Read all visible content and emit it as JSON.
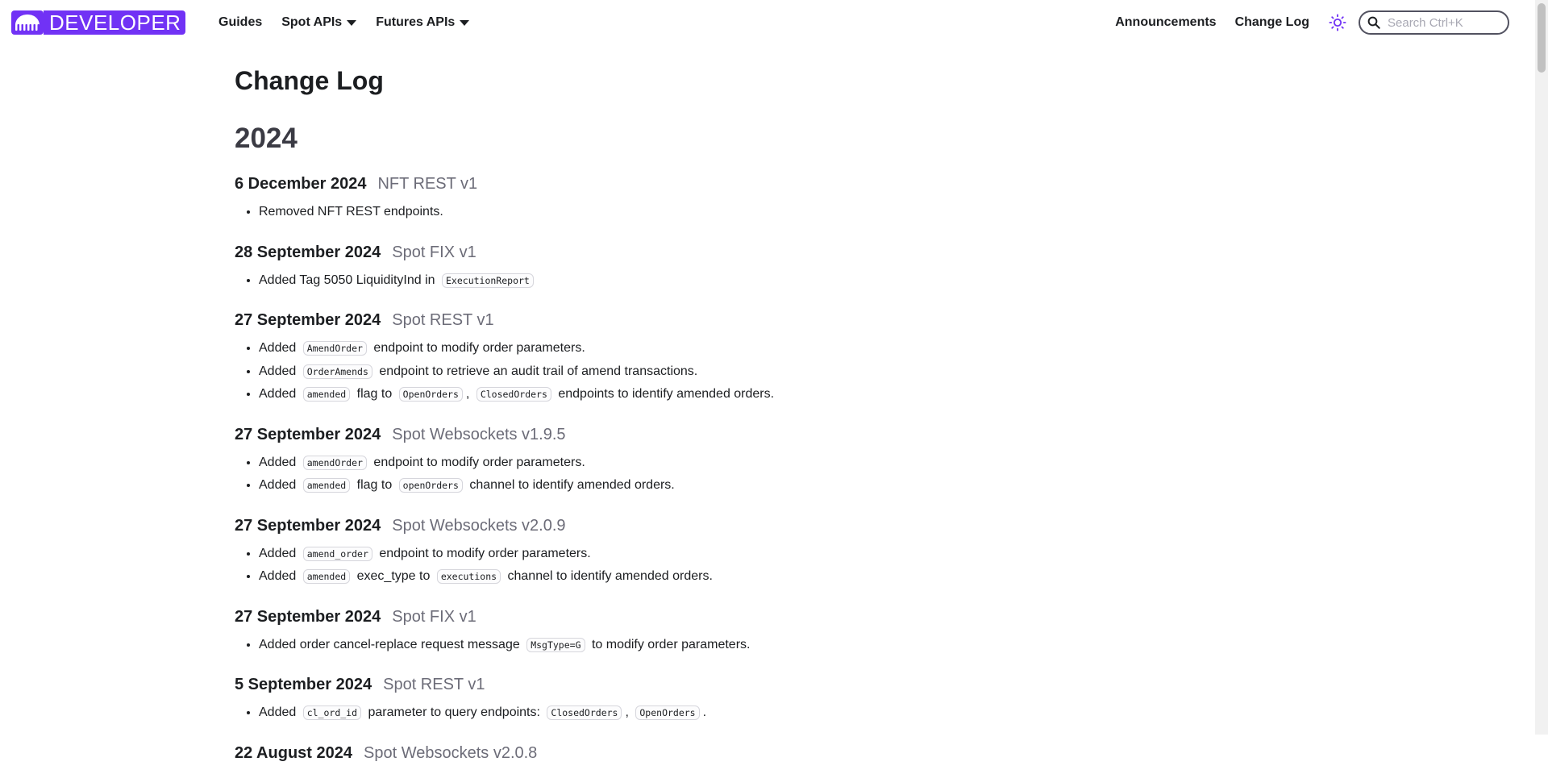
{
  "nav": {
    "logo_label": "DEVELOPER",
    "left_links": [
      {
        "label": "Guides",
        "dropdown": false
      },
      {
        "label": "Spot APIs",
        "dropdown": true
      },
      {
        "label": "Futures APIs",
        "dropdown": true
      }
    ],
    "right_links": [
      "Announcements",
      "Change Log"
    ],
    "search_placeholder": "Search Ctrl+K",
    "theme_icon": "sun-icon"
  },
  "colors": {
    "brand": "#7132f5",
    "tag": "#6c6c78"
  },
  "page": {
    "title": "Change Log",
    "year": "2024"
  },
  "entries": [
    {
      "date": "6 December 2024",
      "tag": "NFT REST v1",
      "items": [
        [
          {
            "t": "Removed NFT REST endpoints."
          }
        ]
      ]
    },
    {
      "date": "28 September 2024",
      "tag": "Spot FIX v1",
      "items": [
        [
          {
            "t": "Added Tag 5050 LiquidityInd in "
          },
          {
            "c": "ExecutionReport"
          }
        ]
      ]
    },
    {
      "date": "27 September 2024",
      "tag": "Spot REST v1",
      "items": [
        [
          {
            "t": "Added "
          },
          {
            "c": "AmendOrder"
          },
          {
            "t": " endpoint to modify order parameters."
          }
        ],
        [
          {
            "t": "Added "
          },
          {
            "c": "OrderAmends"
          },
          {
            "t": " endpoint to retrieve an audit trail of amend transactions."
          }
        ],
        [
          {
            "t": "Added "
          },
          {
            "c": "amended"
          },
          {
            "t": " flag to "
          },
          {
            "c": "OpenOrders"
          },
          {
            "t": ", "
          },
          {
            "c": "ClosedOrders"
          },
          {
            "t": " endpoints to identify amended orders."
          }
        ]
      ]
    },
    {
      "date": "27 September 2024",
      "tag": "Spot Websockets v1.9.5",
      "items": [
        [
          {
            "t": "Added "
          },
          {
            "c": "amendOrder"
          },
          {
            "t": " endpoint to modify order parameters."
          }
        ],
        [
          {
            "t": "Added "
          },
          {
            "c": "amended"
          },
          {
            "t": " flag to "
          },
          {
            "c": "openOrders"
          },
          {
            "t": " channel to identify amended orders."
          }
        ]
      ]
    },
    {
      "date": "27 September 2024",
      "tag": "Spot Websockets v2.0.9",
      "items": [
        [
          {
            "t": "Added "
          },
          {
            "c": "amend_order"
          },
          {
            "t": " endpoint to modify order parameters."
          }
        ],
        [
          {
            "t": "Added "
          },
          {
            "c": "amended"
          },
          {
            "t": " exec_type to "
          },
          {
            "c": "executions"
          },
          {
            "t": " channel to identify amended orders."
          }
        ]
      ]
    },
    {
      "date": "27 September 2024",
      "tag": "Spot FIX v1",
      "items": [
        [
          {
            "t": "Added order cancel-replace request message "
          },
          {
            "c": "MsgType=G"
          },
          {
            "t": " to modify order parameters."
          }
        ]
      ]
    },
    {
      "date": "5 September 2024",
      "tag": "Spot REST v1",
      "items": [
        [
          {
            "t": "Added "
          },
          {
            "c": "cl_ord_id"
          },
          {
            "t": " parameter to query endpoints: "
          },
          {
            "c": "ClosedOrders"
          },
          {
            "t": ", "
          },
          {
            "c": "OpenOrders"
          },
          {
            "t": "."
          }
        ]
      ]
    },
    {
      "date": "22 August 2024",
      "tag": "Spot Websockets v2.0.8",
      "items": []
    }
  ]
}
